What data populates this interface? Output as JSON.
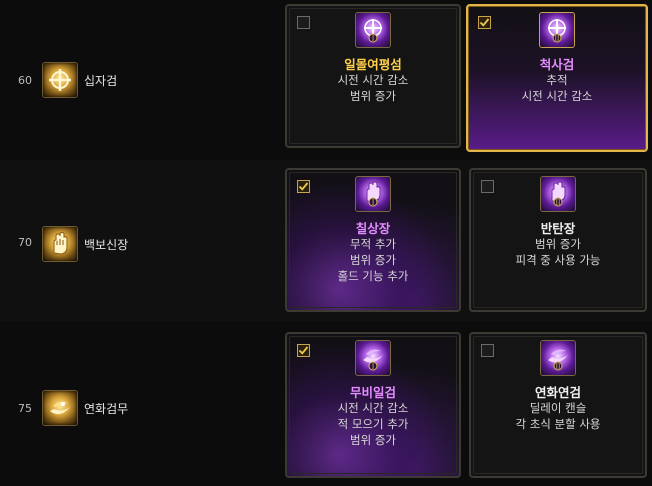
{
  "rows": [
    {
      "level": "60",
      "skill_name": "십자검",
      "skill_icon": "cross-sword-icon",
      "options": [
        {
          "tier_icon": "tier-1-icon",
          "checked": false,
          "title": "일몰여평섬",
          "lines": [
            "시전 시간 감소",
            "범위 증가"
          ]
        },
        {
          "tier_icon": "tier-2-icon",
          "checked": true,
          "title": "척사검",
          "lines": [
            "추적",
            "시전 시간 감소"
          ]
        }
      ]
    },
    {
      "level": "70",
      "skill_name": "백보신장",
      "skill_icon": "palm-icon",
      "options": [
        {
          "tier_icon": "tier-1-icon",
          "checked": true,
          "title": "칠상장",
          "lines": [
            "무적 추가",
            "범위 증가",
            "홀드 기능 추가"
          ]
        },
        {
          "tier_icon": "tier-2-icon",
          "checked": false,
          "title": "반탄장",
          "lines": [
            "범위 증가",
            "피격 중 사용 가능"
          ]
        }
      ]
    },
    {
      "level": "75",
      "skill_name": "연화검무",
      "skill_icon": "lotus-blade-icon",
      "options": [
        {
          "tier_icon": "tier-1-icon",
          "checked": true,
          "title": "무비일검",
          "lines": [
            "시전 시간 감소",
            "적 모으기 추가",
            "범위 증가"
          ]
        },
        {
          "tier_icon": "tier-2-icon",
          "checked": false,
          "title": "연화연검",
          "lines": [
            "딜레이 캔슬",
            "각 초식 분할 사용"
          ]
        }
      ]
    }
  ],
  "colors": {
    "gold": "#ffd04a",
    "purple_title": "#e48cff",
    "selected_border": "#e3b54a"
  }
}
